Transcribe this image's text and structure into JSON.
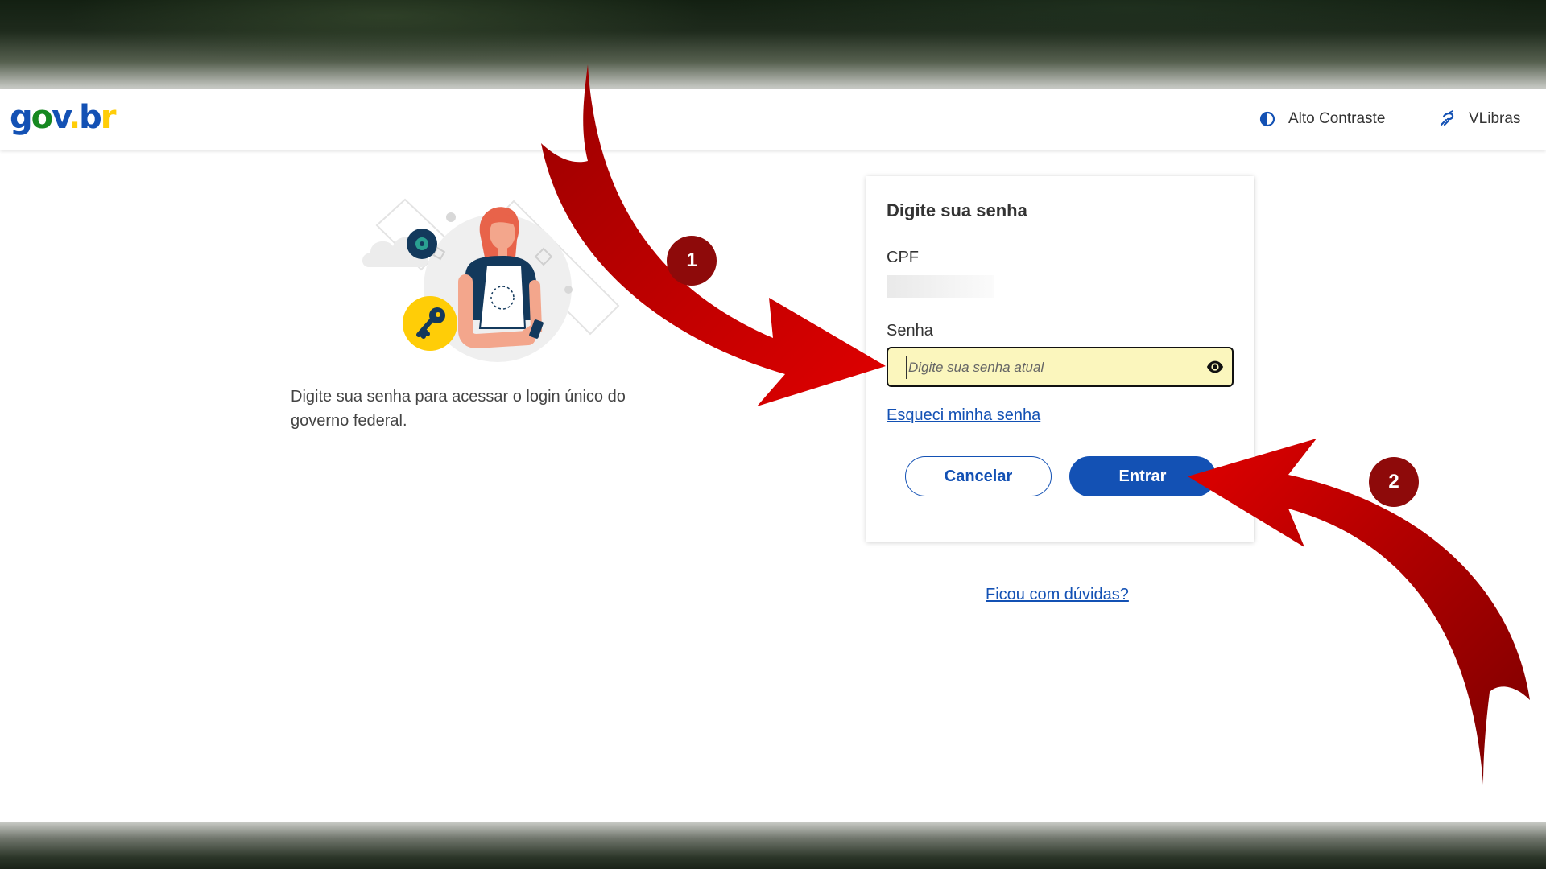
{
  "header": {
    "logo": {
      "g": "g",
      "o": "o",
      "v": "v",
      "dot": ".",
      "b": "b",
      "r": "r"
    },
    "links": [
      {
        "label": "Alto Contraste",
        "icon": "contrast-icon"
      },
      {
        "label": "VLibras",
        "icon": "vlibras-hand-icon"
      }
    ]
  },
  "intro": {
    "text": "Digite sua senha para acessar o login único do governo federal."
  },
  "form": {
    "title": "Digite sua senha",
    "cpf_label": "CPF",
    "cpf_value": "",
    "password_label": "Senha",
    "password_placeholder": "Digite sua senha atual",
    "password_value": "",
    "forgot_link": "Esqueci minha senha",
    "cancel_label": "Cancelar",
    "submit_label": "Entrar"
  },
  "help_link": "Ficou com dúvidas?",
  "annotations": [
    {
      "number": "1"
    },
    {
      "number": "2"
    }
  ],
  "colors": {
    "primary": "#1351b4",
    "arrow": "#c00000",
    "badge": "#8e0a0a",
    "input_highlight": "#fbf6bd"
  }
}
